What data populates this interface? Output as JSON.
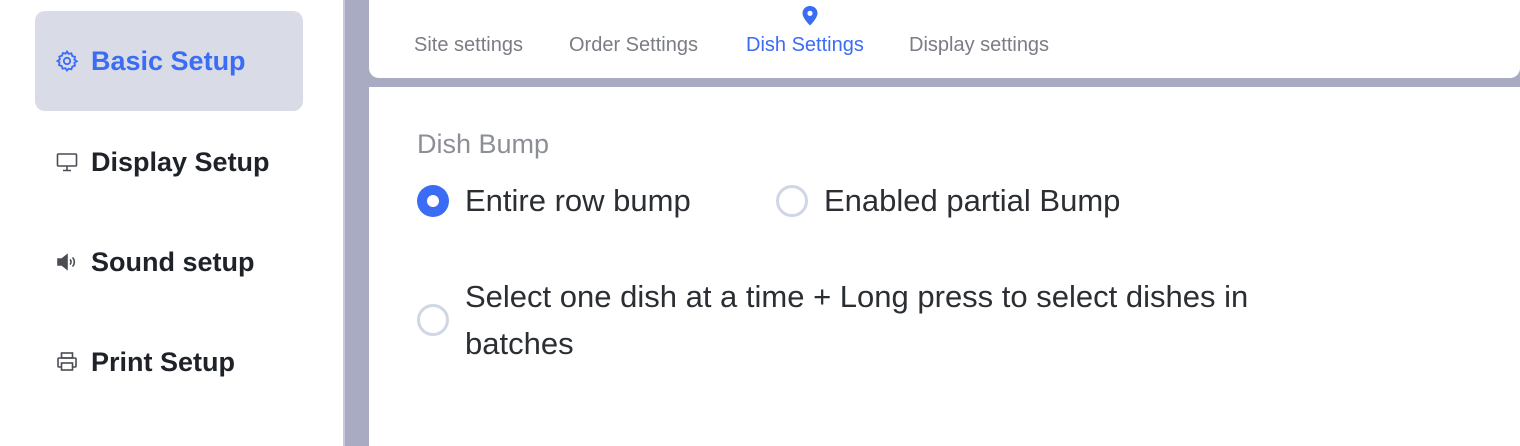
{
  "sidebar": {
    "items": [
      {
        "label": "Basic Setup",
        "icon": "gear-icon",
        "active": true
      },
      {
        "label": "Display Setup",
        "icon": "monitor-icon",
        "active": false
      },
      {
        "label": "Sound setup",
        "icon": "speaker-icon",
        "active": false
      },
      {
        "label": "Print Setup",
        "icon": "printer-icon",
        "active": false
      }
    ]
  },
  "tabs": [
    {
      "label": "Site settings",
      "active": false
    },
    {
      "label": "Order Settings",
      "active": false
    },
    {
      "label": "Dish Settings",
      "active": true
    },
    {
      "label": "Display settings",
      "active": false
    }
  ],
  "section": {
    "title": "Dish Bump",
    "options": [
      {
        "label": "Entire row bump",
        "checked": true
      },
      {
        "label": "Enabled partial Bump",
        "checked": false
      },
      {
        "label": "Select one dish at a time + Long press to select dishes in batches",
        "checked": false
      }
    ]
  },
  "colors": {
    "accent": "#3a6cf4",
    "active_nav_bg": "#d9dbe7",
    "divider": "#a9abc3",
    "text": "#1f2329",
    "muted": "#7a7d85"
  }
}
